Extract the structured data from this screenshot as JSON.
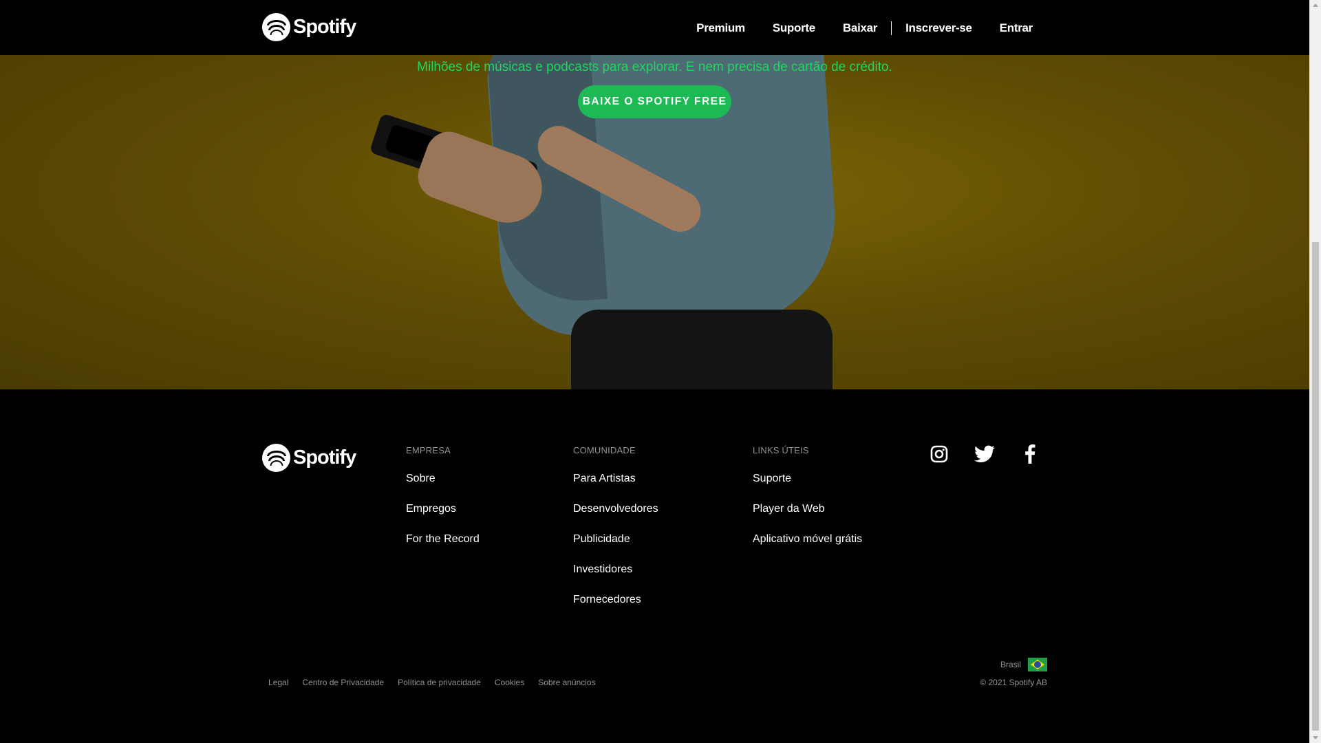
{
  "header": {
    "logo_text": "Spotify",
    "nav": {
      "premium": "Premium",
      "support": "Suporte",
      "download": "Baixar",
      "signup": "Inscrever-se",
      "login": "Entrar"
    }
  },
  "hero": {
    "tagline": "Milhões de músicas e podcasts para explorar. E nem precisa de cartão de crédito.",
    "cta_label": "BAIXE O SPOTIFY FREE"
  },
  "footer": {
    "logo_text": "Spotify",
    "columns": [
      {
        "title": "EMPRESA",
        "links": [
          "Sobre",
          "Empregos",
          "For the Record"
        ]
      },
      {
        "title": "COMUNIDADE",
        "links": [
          "Para Artistas",
          "Desenvolvedores",
          "Publicidade",
          "Investidores",
          "Fornecedores"
        ]
      },
      {
        "title": "LINKS ÚTEIS",
        "links": [
          "Suporte",
          "Player da Web",
          "Aplicativo móvel grátis"
        ]
      }
    ],
    "social": [
      "instagram-icon",
      "twitter-icon",
      "facebook-icon"
    ],
    "legal_links": [
      "Legal",
      "Centro de Privacidade",
      "Política de privacidade",
      "Cookies",
      "Sobre anúncios"
    ],
    "country": "Brasil",
    "copyright": "© 2021 Spotify AB"
  },
  "colors": {
    "accent_green": "#1ed760",
    "button_green": "#1db954",
    "muted_text": "#919496"
  }
}
